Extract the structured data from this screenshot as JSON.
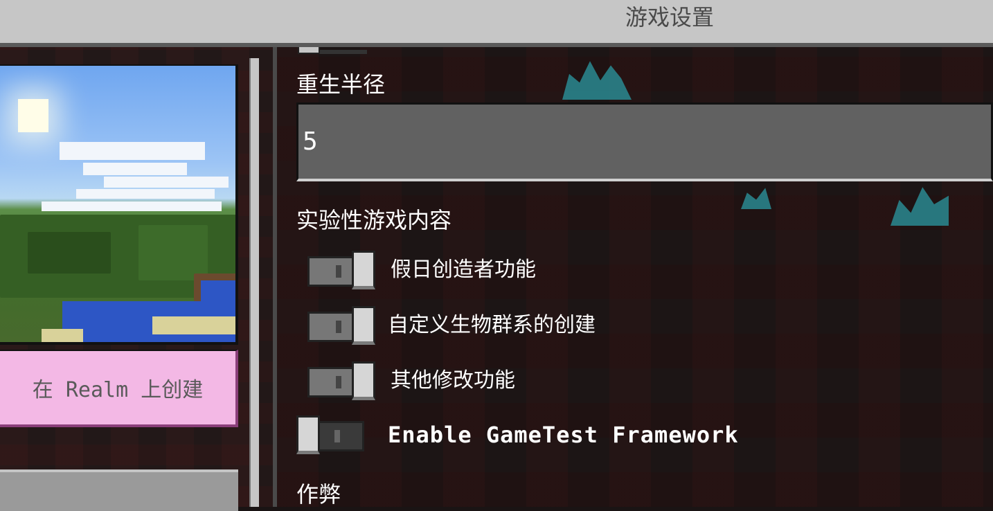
{
  "window": {
    "title": "游戏设置"
  },
  "left_panel": {
    "realm_button_label": "在 Realm 上创建"
  },
  "settings": {
    "respawn_radius": {
      "label": "重生半径",
      "value": "5"
    },
    "experimental_section_label": "实验性游戏内容",
    "toggles": [
      {
        "label": "假日创造者功能",
        "state": "on"
      },
      {
        "label": "自定义生物群系的创建",
        "state": "on"
      },
      {
        "label": "其他修改功能",
        "state": "on"
      },
      {
        "label": "Enable GameTest Framework",
        "state": "off"
      }
    ],
    "cheats_section_label": "作弊"
  },
  "colors": {
    "title_bar": "#c6c6c6",
    "realm_button": "#f3b8e5",
    "text_field": "#616161"
  }
}
